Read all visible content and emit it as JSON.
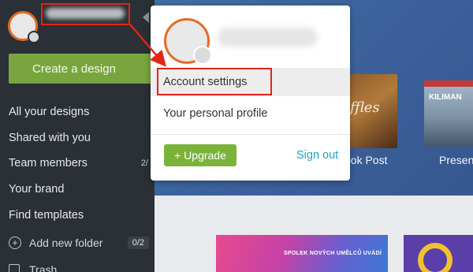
{
  "sidebar": {
    "create_button": "Create a design",
    "items": [
      {
        "label": "All your designs",
        "count": ""
      },
      {
        "label": "Shared with you",
        "count": ""
      },
      {
        "label": "Team members",
        "count": "2/"
      },
      {
        "label": "Your brand",
        "count": ""
      },
      {
        "label": "Find templates",
        "count": ""
      }
    ],
    "add_folder": {
      "label": "Add new folder",
      "count": "0/2"
    },
    "trash": "Trash"
  },
  "menu": {
    "items": [
      {
        "label": "Account settings"
      },
      {
        "label": "Your personal profile"
      }
    ],
    "upgrade": "+ Upgrade",
    "sign_out": "Sign out"
  },
  "main": {
    "thumb_labels": {
      "post": "ook Post",
      "present": "Present"
    },
    "thumb_present_title": "KILIMAN",
    "card_text": "SPOLEK NOVÝCH UMĚLCŮ UVÁDÍ"
  },
  "colors": {
    "accent_green": "#79a53f",
    "annotation_red": "#e2241b",
    "link_blue": "#1aa3c8",
    "sidebar_bg": "#2b3036"
  },
  "icons": [
    "add-folder-icon",
    "trash-icon",
    "caret-left-icon"
  ]
}
